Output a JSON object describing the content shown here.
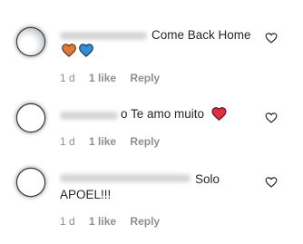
{
  "comments": [
    {
      "text": "Come Back Home",
      "hearts": [
        "orange",
        "blue"
      ],
      "age": "1 d",
      "likes": "1 like",
      "reply": "Reply"
    },
    {
      "text": "o Te amo muito",
      "hearts": [
        "red"
      ],
      "age": "1 d",
      "likes": "1 like",
      "reply": "Reply"
    },
    {
      "text_line1": "Solo",
      "text_line2": "APOEL!!!",
      "age": "1 d",
      "likes": "1 like",
      "reply": "Reply"
    }
  ],
  "colors": {
    "heart_orange": "#e07a3a",
    "heart_blue": "#2f8fd8",
    "heart_red": "#dd2e44",
    "meta": "#8e8e8e",
    "text": "#262626"
  }
}
